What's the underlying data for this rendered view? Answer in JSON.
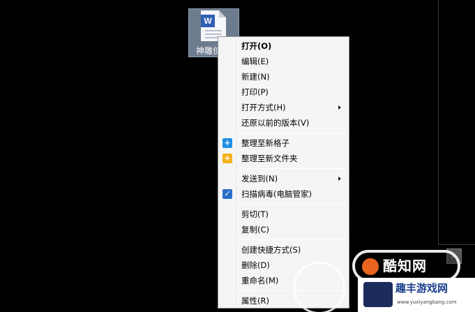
{
  "desktop_file": {
    "label": "神雕侠",
    "badge": "W"
  },
  "context_menu": {
    "groups": [
      [
        {
          "label": "打开(O)",
          "bold": true
        },
        {
          "label": "编辑(E)"
        },
        {
          "label": "新建(N)"
        },
        {
          "label": "打印(P)"
        },
        {
          "label": "打开方式(H)",
          "submenu": true
        },
        {
          "label": "还原以前的版本(V)"
        }
      ],
      [
        {
          "label": "整理至新格子",
          "icon": "plus-blue-icon"
        },
        {
          "label": "整理至新文件夹",
          "icon": "plus-folder-icon"
        }
      ],
      [
        {
          "label": "发送到(N)",
          "submenu": true
        },
        {
          "label": "扫描病毒(电脑管家)",
          "icon": "shield-icon"
        }
      ],
      [
        {
          "label": "剪切(T)"
        },
        {
          "label": "复制(C)"
        }
      ],
      [
        {
          "label": "创建快捷方式(S)"
        },
        {
          "label": "删除(D)"
        },
        {
          "label": "重命名(M)"
        }
      ],
      [
        {
          "label": "属性(R)"
        }
      ]
    ]
  },
  "watermark": {
    "badge_text": "酷知网",
    "site_title": "趣丰游戏网",
    "site_url": "www.yuxiyangbang.com"
  },
  "colors": {
    "menu_bg": "#f5f5f5",
    "desktop_bg": "#000000",
    "icon_blue": "#1e8fe1",
    "icon_yellow": "#f5b21c"
  }
}
